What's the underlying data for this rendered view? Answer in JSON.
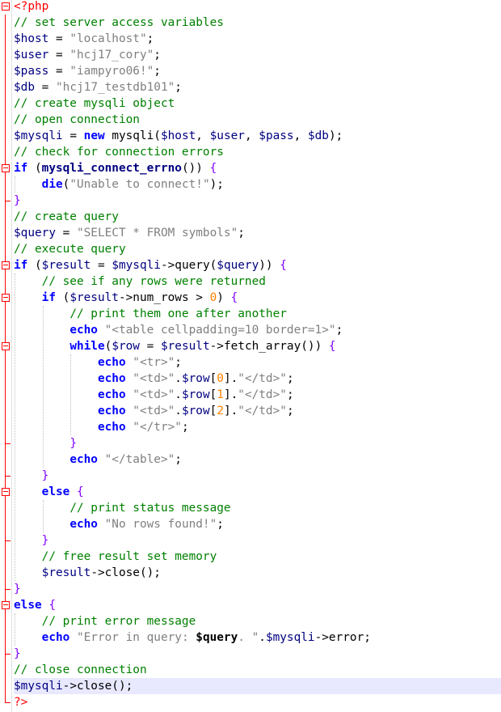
{
  "lines": [
    [
      [
        "phptag",
        "<?php"
      ]
    ],
    [
      [
        "comment",
        "// set server access variables"
      ]
    ],
    [
      [
        "var",
        "$host"
      ],
      [
        "text",
        " = "
      ],
      [
        "string",
        "\"localhost\""
      ],
      [
        "text",
        ";"
      ]
    ],
    [
      [
        "var",
        "$user"
      ],
      [
        "text",
        " = "
      ],
      [
        "string",
        "\"hcj17_cory\""
      ],
      [
        "text",
        ";"
      ]
    ],
    [
      [
        "var",
        "$pass"
      ],
      [
        "text",
        " = "
      ],
      [
        "string",
        "\"iampyro06!\""
      ],
      [
        "text",
        ";"
      ]
    ],
    [
      [
        "var",
        "$db"
      ],
      [
        "text",
        " = "
      ],
      [
        "string",
        "\"hcj17_testdb101\""
      ],
      [
        "text",
        ";"
      ]
    ],
    [
      [
        "comment",
        "// create mysqli object"
      ]
    ],
    [
      [
        "comment",
        "// open connection"
      ]
    ],
    [
      [
        "var",
        "$mysqli"
      ],
      [
        "text",
        " = "
      ],
      [
        "keyword",
        "new"
      ],
      [
        "text",
        " mysqli("
      ],
      [
        "var",
        "$host"
      ],
      [
        "text",
        ", "
      ],
      [
        "var",
        "$user"
      ],
      [
        "text",
        ", "
      ],
      [
        "var",
        "$pass"
      ],
      [
        "text",
        ", "
      ],
      [
        "var",
        "$db"
      ],
      [
        "text",
        ");"
      ]
    ],
    [
      [
        "comment",
        "// check for connection errors"
      ]
    ],
    [
      [
        "keyword",
        "if"
      ],
      [
        "text",
        " ("
      ],
      [
        "funcbold",
        "mysqli_connect_errno"
      ],
      [
        "text",
        "()) "
      ],
      [
        "brace",
        "{"
      ]
    ],
    [
      [
        "text",
        "    "
      ],
      [
        "keyword",
        "die"
      ],
      [
        "text",
        "("
      ],
      [
        "string",
        "\"Unable to connect!\""
      ],
      [
        "text",
        ");"
      ]
    ],
    [
      [
        "brace",
        "}"
      ]
    ],
    [
      [
        "comment",
        "// create query"
      ]
    ],
    [
      [
        "var",
        "$query"
      ],
      [
        "text",
        " = "
      ],
      [
        "string",
        "\"SELECT * FROM symbols\""
      ],
      [
        "text",
        ";"
      ]
    ],
    [
      [
        "comment",
        "// execute query"
      ]
    ],
    [
      [
        "keyword",
        "if"
      ],
      [
        "text",
        " ("
      ],
      [
        "var",
        "$result"
      ],
      [
        "text",
        " = "
      ],
      [
        "var",
        "$mysqli"
      ],
      [
        "text",
        "->query("
      ],
      [
        "var",
        "$query"
      ],
      [
        "text",
        ")) "
      ],
      [
        "brace",
        "{"
      ]
    ],
    [
      [
        "text",
        "    "
      ],
      [
        "comment",
        "// see if any rows were returned"
      ]
    ],
    [
      [
        "text",
        "    "
      ],
      [
        "keyword",
        "if"
      ],
      [
        "text",
        " ("
      ],
      [
        "var",
        "$result"
      ],
      [
        "text",
        "->num_rows > "
      ],
      [
        "num",
        "0"
      ],
      [
        "text",
        ") "
      ],
      [
        "brace",
        "{"
      ]
    ],
    [
      [
        "text",
        "        "
      ],
      [
        "comment",
        "// print them one after another"
      ]
    ],
    [
      [
        "text",
        "        "
      ],
      [
        "keyword",
        "echo"
      ],
      [
        "text",
        " "
      ],
      [
        "string",
        "\"<table cellpadding=10 border=1>\""
      ],
      [
        "text",
        ";"
      ]
    ],
    [
      [
        "text",
        "        "
      ],
      [
        "keyword",
        "while"
      ],
      [
        "text",
        "("
      ],
      [
        "var",
        "$row"
      ],
      [
        "text",
        " = "
      ],
      [
        "var",
        "$result"
      ],
      [
        "text",
        "->fetch_array()) "
      ],
      [
        "brace",
        "{"
      ]
    ],
    [
      [
        "text",
        "            "
      ],
      [
        "keyword",
        "echo"
      ],
      [
        "text",
        " "
      ],
      [
        "string",
        "\"<tr>\""
      ],
      [
        "text",
        ";"
      ]
    ],
    [
      [
        "text",
        "            "
      ],
      [
        "keyword",
        "echo"
      ],
      [
        "text",
        " "
      ],
      [
        "string",
        "\"<td>\""
      ],
      [
        "text",
        "."
      ],
      [
        "var",
        "$row"
      ],
      [
        "text",
        "["
      ],
      [
        "num",
        "0"
      ],
      [
        "text",
        "]."
      ],
      [
        "string",
        "\"</td>\""
      ],
      [
        "text",
        ";"
      ]
    ],
    [
      [
        "text",
        "            "
      ],
      [
        "keyword",
        "echo"
      ],
      [
        "text",
        " "
      ],
      [
        "string",
        "\"<td>\""
      ],
      [
        "text",
        "."
      ],
      [
        "var",
        "$row"
      ],
      [
        "text",
        "["
      ],
      [
        "num",
        "1"
      ],
      [
        "text",
        "]."
      ],
      [
        "string",
        "\"</td>\""
      ],
      [
        "text",
        ";"
      ]
    ],
    [
      [
        "text",
        "            "
      ],
      [
        "keyword",
        "echo"
      ],
      [
        "text",
        " "
      ],
      [
        "string",
        "\"<td>\""
      ],
      [
        "text",
        "."
      ],
      [
        "var",
        "$row"
      ],
      [
        "text",
        "["
      ],
      [
        "num",
        "2"
      ],
      [
        "text",
        "]."
      ],
      [
        "string",
        "\"</td>\""
      ],
      [
        "text",
        ";"
      ]
    ],
    [
      [
        "text",
        "            "
      ],
      [
        "keyword",
        "echo"
      ],
      [
        "text",
        " "
      ],
      [
        "string",
        "\"</tr>\""
      ],
      [
        "text",
        ";"
      ]
    ],
    [
      [
        "text",
        "        "
      ],
      [
        "brace",
        "}"
      ]
    ],
    [
      [
        "text",
        "        "
      ],
      [
        "keyword",
        "echo"
      ],
      [
        "text",
        " "
      ],
      [
        "string",
        "\"</table>\""
      ],
      [
        "text",
        ";"
      ]
    ],
    [
      [
        "text",
        "    "
      ],
      [
        "brace",
        "}"
      ]
    ],
    [
      [
        "text",
        "    "
      ],
      [
        "keyword",
        "else"
      ],
      [
        "text",
        " "
      ],
      [
        "brace",
        "{"
      ]
    ],
    [
      [
        "text",
        "        "
      ],
      [
        "comment",
        "// print status message"
      ]
    ],
    [
      [
        "text",
        "        "
      ],
      [
        "keyword",
        "echo"
      ],
      [
        "text",
        " "
      ],
      [
        "string",
        "\"No rows found!\""
      ],
      [
        "text",
        ";"
      ]
    ],
    [
      [
        "text",
        "    "
      ],
      [
        "brace",
        "}"
      ]
    ],
    [
      [
        "text",
        "    "
      ],
      [
        "comment",
        "// free result set memory"
      ]
    ],
    [
      [
        "text",
        "    "
      ],
      [
        "var",
        "$result"
      ],
      [
        "text",
        "->close();"
      ]
    ],
    [
      [
        "brace",
        "}"
      ]
    ],
    [
      [
        "keyword",
        "else"
      ],
      [
        "text",
        " "
      ],
      [
        "brace",
        "{"
      ]
    ],
    [
      [
        "text",
        "    "
      ],
      [
        "comment",
        "// print error message"
      ]
    ],
    [
      [
        "text",
        "    "
      ],
      [
        "keyword",
        "echo"
      ],
      [
        "text",
        " "
      ],
      [
        "string",
        "\"Error in query: "
      ],
      [
        "bold",
        "$query"
      ],
      [
        "string",
        ". \""
      ],
      [
        "text",
        "."
      ],
      [
        "var",
        "$mysqli"
      ],
      [
        "text",
        "->error;"
      ]
    ],
    [
      [
        "brace",
        "}"
      ]
    ],
    [
      [
        "comment",
        "// close connection"
      ]
    ],
    [
      [
        "var",
        "$mysqli"
      ],
      [
        "text",
        "->close();"
      ]
    ],
    [
      [
        "phptag",
        "?>"
      ]
    ]
  ],
  "current_line": 42,
  "colors": {
    "comment": "#008000",
    "string": "#808080",
    "variable": "#000080",
    "keyword": "#0000ff",
    "brace": "#8000ff",
    "number": "#ff8000",
    "php_tag": "#ff0000",
    "fold_marker": "#ff0000",
    "current_line_bg": "#e8e8ff"
  },
  "icons": {
    "fold_open": "fold-minus-icon",
    "fold_end": "fold-end-icon"
  }
}
